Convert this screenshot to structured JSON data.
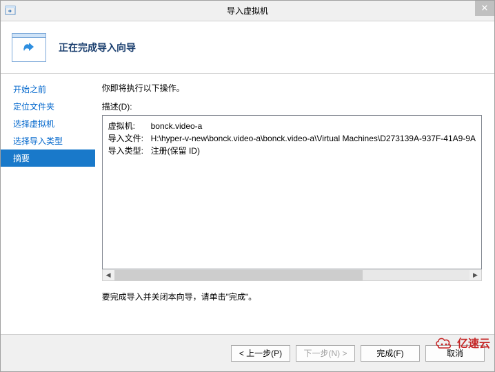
{
  "window": {
    "title": "导入虚拟机",
    "close_glyph": "✕"
  },
  "header": {
    "heading": "正在完成导入向导"
  },
  "sidebar": {
    "items": [
      {
        "label": "开始之前",
        "selected": false
      },
      {
        "label": "定位文件夹",
        "selected": false
      },
      {
        "label": "选择虚拟机",
        "selected": false
      },
      {
        "label": "选择导入类型",
        "selected": false
      },
      {
        "label": "摘要",
        "selected": true
      }
    ]
  },
  "main": {
    "intro": "你即将执行以下操作。",
    "desc_label": "描述(D):",
    "summary": [
      {
        "key": "虚拟机:",
        "value": "bonck.video-a"
      },
      {
        "key": "导入文件:",
        "value": "H:\\hyper-v-new\\bonck.video-a\\bonck.video-a\\Virtual Machines\\D273139A-937F-41A9-9A"
      },
      {
        "key": "导入类型:",
        "value": "注册(保留 ID)"
      }
    ],
    "finish_text": "要完成导入并关闭本向导，请单击\"完成\"。",
    "scroll_left": "◀",
    "scroll_right": "▶"
  },
  "footer": {
    "prev": "< 上一步(P)",
    "next": "下一步(N) >",
    "finish": "完成(F)",
    "cancel": "取消"
  },
  "watermark": {
    "text": "亿速云"
  }
}
